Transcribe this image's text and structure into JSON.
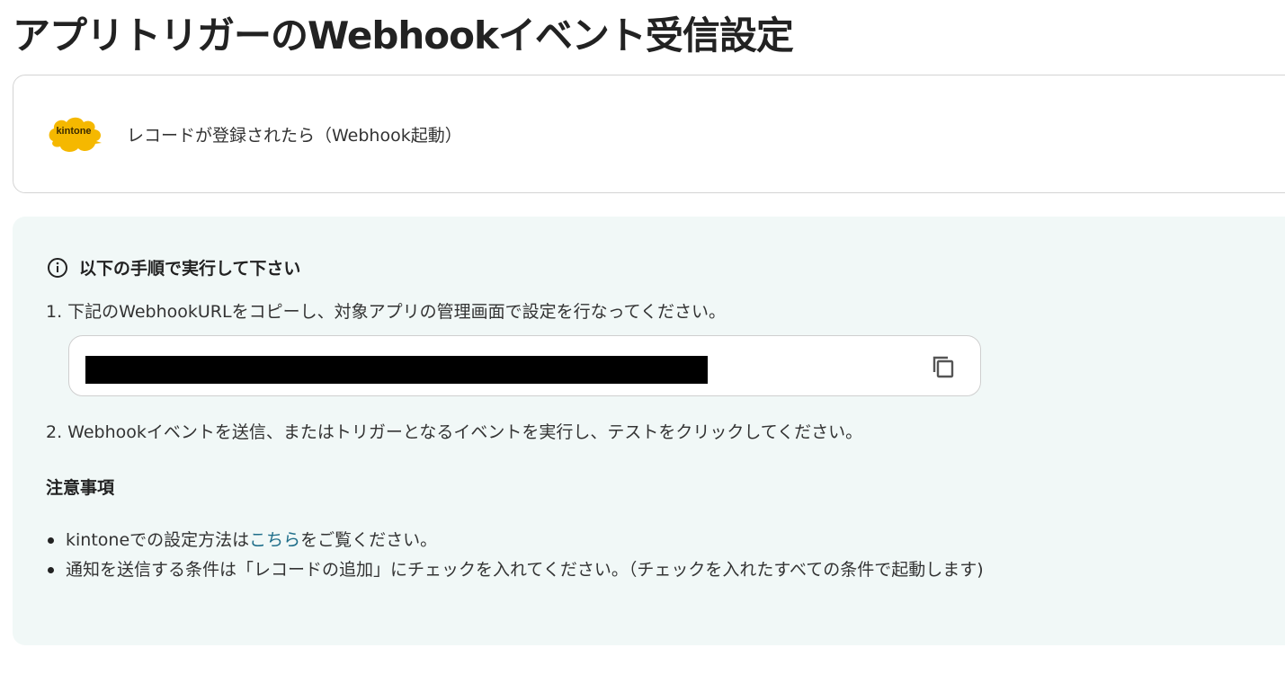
{
  "page": {
    "title": "アプリトリガーのWebhookイベント受信設定"
  },
  "trigger": {
    "logo_text": "kintone",
    "name": "レコードが登録されたら（Webhook起動）",
    "logo_color": "#f5b800"
  },
  "instructions": {
    "heading": "以下の手順で実行して下さい",
    "step1": "1. 下記のWebhookURLをコピーし、対象アプリの管理画面で設定を行なってください。",
    "url_value": "",
    "step2": "2. Webhookイベントを送信、またはトリガーとなるイベントを実行し、テストをクリックしてください。",
    "background_color": "#f1f8f7"
  },
  "notes": {
    "heading": "注意事項",
    "item1_prefix": "kintoneでの設定方法は",
    "item1_link": "こちら",
    "item1_suffix": "をご覧ください。",
    "item2": "通知を送信する条件は「レコードの追加」にチェックを入れてください。（チェックを入れたすべての条件で起動します)",
    "link_color": "#1f6e8a"
  },
  "icons": {
    "info": "info-icon",
    "copy": "copy-icon"
  }
}
